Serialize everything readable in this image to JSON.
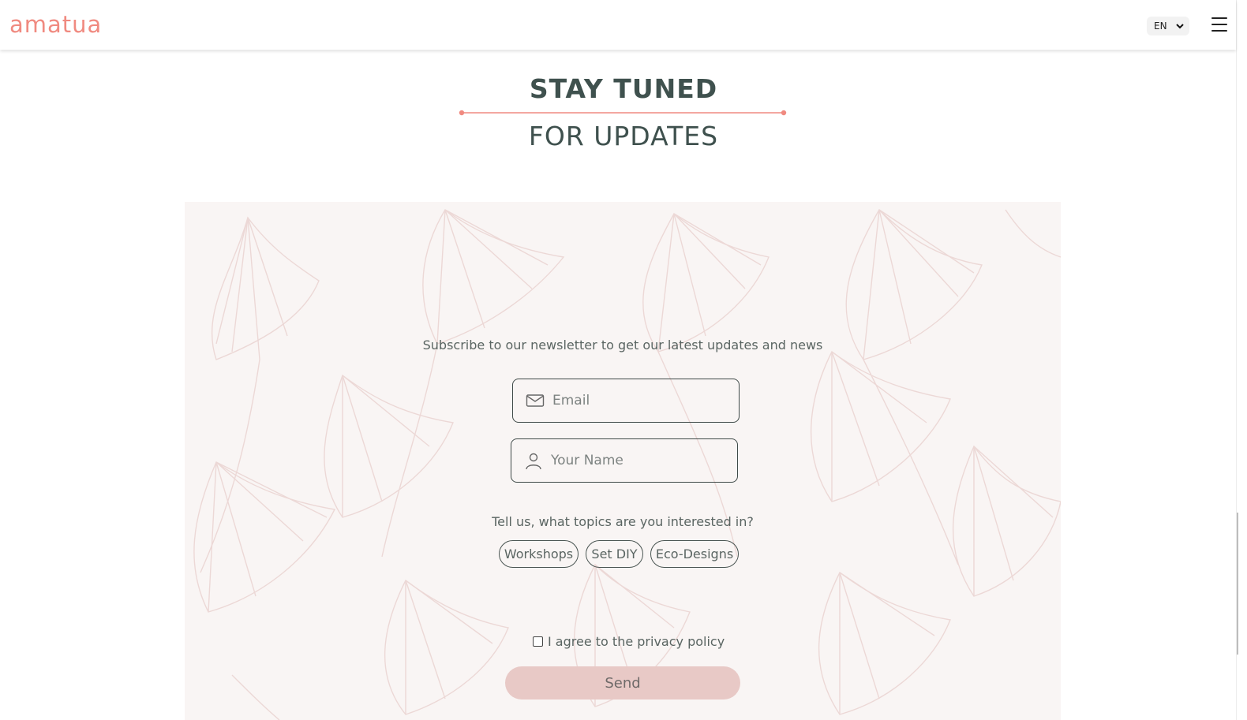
{
  "header": {
    "logo_text": "amatua",
    "language": {
      "selected": "EN",
      "options": [
        "EN"
      ]
    },
    "menu_icon": "hamburger-menu-icon"
  },
  "hero": {
    "title": "STAY TUNED",
    "subtitle": "FOR UPDATES"
  },
  "form": {
    "intro": "Subscribe to our newsletter to get our latest updates and news",
    "email": {
      "placeholder": "Email",
      "value": "",
      "icon": "envelope-icon"
    },
    "name": {
      "placeholder": "Your Name",
      "value": "",
      "icon": "person-icon"
    },
    "topics_question": "Tell us, what topics are you interested in?",
    "topics": [
      "Workshops",
      "Set DIY",
      "Eco-Designs"
    ],
    "privacy_label": "I agree to the privacy policy",
    "privacy_checked": false,
    "send_label": "Send"
  },
  "colors": {
    "accent": "#f08a80",
    "heading": "#3f514e",
    "panel_bg": "#f9f5f4",
    "send_bg": "#e8c9c6"
  }
}
